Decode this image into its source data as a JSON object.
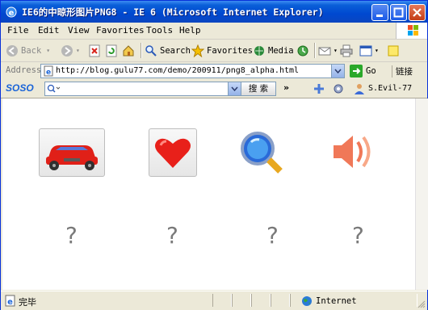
{
  "window": {
    "title": "IE6的中晾形图片PNG8 - IE 6 (Microsoft Internet Explorer)"
  },
  "menu": [
    "File",
    "Edit",
    "View",
    "Favorites",
    "Tools",
    "Help"
  ],
  "toolbar": {
    "back": "Back",
    "search": "Search",
    "favorites": "Favorites",
    "media": "Media"
  },
  "address": {
    "label": "Address",
    "url": "http://blog.gulu77.com/demo/200911/png8_alpha.html",
    "go": "Go",
    "links": "链接"
  },
  "soso": {
    "logo": "SOSO",
    "search_button": "搜 索",
    "user": "S.Evil-77"
  },
  "content": {
    "items": [
      {
        "icon": "car-icon",
        "caption": "?"
      },
      {
        "icon": "heart-icon",
        "caption": "?"
      },
      {
        "icon": "magnifier-icon",
        "caption": "?"
      },
      {
        "icon": "speaker-icon",
        "caption": "?"
      }
    ]
  },
  "status": {
    "text": "完毕",
    "zone": "Internet"
  },
  "colors": {
    "titlebar": "#0a5fd8",
    "chrome": "#ece9d8",
    "link_blue": "#1a64d8"
  }
}
